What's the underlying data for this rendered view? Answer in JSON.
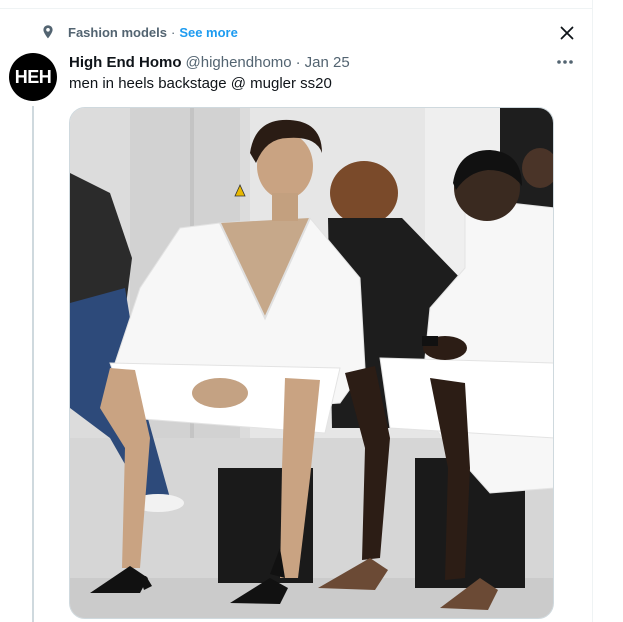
{
  "social_context": {
    "label": "Fashion models",
    "separator": "·",
    "see_more": "See more"
  },
  "tweet": {
    "avatar_text": "HEH",
    "display_name": "High End Homo",
    "handle": "@highendhomo",
    "separator": "·",
    "date": "Jan 25",
    "text": "men in heels backstage @ mugler ss20"
  },
  "icons": {
    "topic": "topic-pin-icon",
    "close": "close-icon",
    "more": "more-dots-icon"
  },
  "colors": {
    "link": "#1d9bf0",
    "muted": "#536471",
    "primary_text": "#0f1419",
    "border": "#cfd9de"
  }
}
